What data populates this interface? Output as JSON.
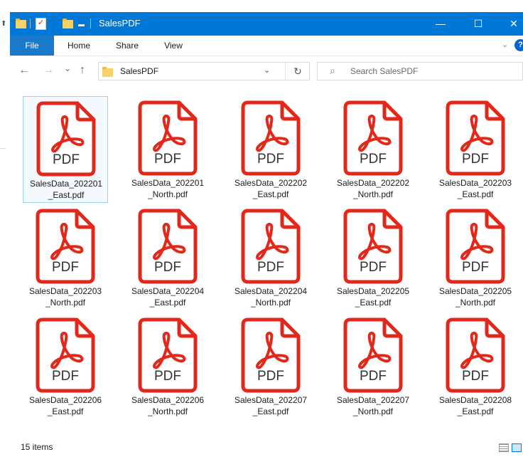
{
  "window": {
    "title": "SalesPDF",
    "controls": {
      "minimize": "—",
      "maximize": "☐",
      "close": "✕"
    }
  },
  "ribbon": {
    "tabs": [
      "File",
      "Home",
      "Share",
      "View"
    ],
    "expand_glyph": "⌄",
    "help_glyph": "?"
  },
  "nav": {
    "back": "←",
    "forward": "→",
    "recent": "⌄",
    "up": "↑",
    "address": "SalesPDF",
    "address_dropdown": "⌄",
    "refresh": "↻",
    "search_icon": "⌕",
    "search_placeholder": "Search SalesPDF"
  },
  "files": {
    "icon_label": "PDF",
    "items": [
      [
        "SalesData_202201",
        "_East.pdf"
      ],
      [
        "SalesData_202201",
        "_North.pdf"
      ],
      [
        "SalesData_202202",
        "_East.pdf"
      ],
      [
        "SalesData_202202",
        "_North.pdf"
      ],
      [
        "SalesData_202203",
        "_East.pdf"
      ],
      [
        "SalesData_202203",
        "_North.pdf"
      ],
      [
        "SalesData_202204",
        "_East.pdf"
      ],
      [
        "SalesData_202204",
        "_North.pdf"
      ],
      [
        "SalesData_202205",
        "_East.pdf"
      ],
      [
        "SalesData_202205",
        "_North.pdf"
      ],
      [
        "SalesData_202206",
        "_East.pdf"
      ],
      [
        "SalesData_202206",
        "_North.pdf"
      ],
      [
        "SalesData_202207",
        "_East.pdf"
      ],
      [
        "SalesData_202207",
        "_North.pdf"
      ],
      [
        "SalesData_202208",
        "_East.pdf"
      ]
    ],
    "selected_index": 0
  },
  "status": {
    "count": "15 items"
  },
  "colors": {
    "titlebar": "#0078d7",
    "file_tab": "#1979ca",
    "pdf_red": "#e3271a",
    "selection_border": "#99d1ff"
  }
}
